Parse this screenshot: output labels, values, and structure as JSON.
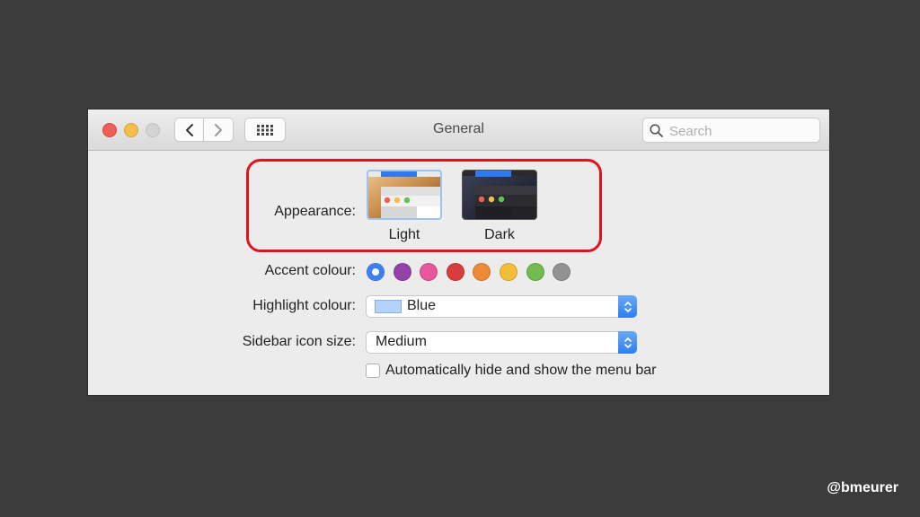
{
  "window": {
    "title": "General"
  },
  "search": {
    "placeholder": "Search"
  },
  "appearance": {
    "label": "Appearance:",
    "options": [
      {
        "label": "Light",
        "selected": true
      },
      {
        "label": "Dark",
        "selected": false
      }
    ]
  },
  "accent": {
    "label": "Accent colour:",
    "colors": [
      "#3b7ff3",
      "#9443a6",
      "#e6579c",
      "#d83c3c",
      "#ed8a35",
      "#f4bd38",
      "#71bb4f",
      "#939393"
    ],
    "selected_index": 0
  },
  "highlight": {
    "label": "Highlight colour:",
    "value": "Blue",
    "chip_color": "#b4d3fb"
  },
  "sidebar_icon": {
    "label": "Sidebar icon size:",
    "value": "Medium"
  },
  "menubar": {
    "label": "Automatically hide and show the menu bar",
    "checked": false
  },
  "watermark": "@bmeurer",
  "colors": {
    "annotation_ring": "#e0141e",
    "desktop_bg": "#3c3c3c"
  }
}
